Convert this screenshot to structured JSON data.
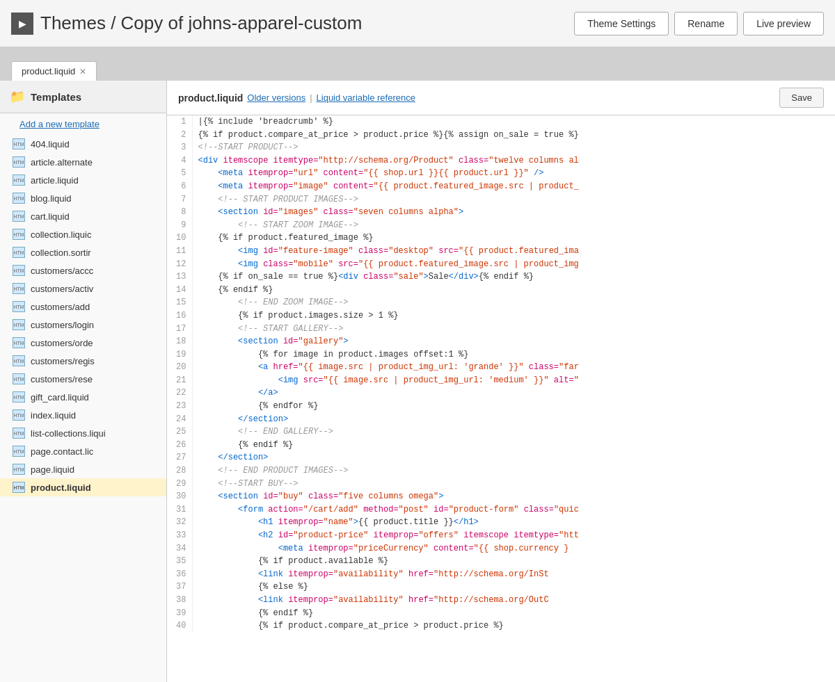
{
  "header": {
    "icon_label": "IMG",
    "title": "Themes / Copy of johns-apparel-custom",
    "theme_settings_label": "Theme Settings",
    "rename_label": "Rename",
    "live_preview_label": "Live preview"
  },
  "tabs": [
    {
      "label": "product.liquid",
      "active": true
    }
  ],
  "sidebar": {
    "title": "Templates",
    "add_template_label": "Add a new template",
    "items": [
      {
        "name": "404.liquid",
        "active": false
      },
      {
        "name": "article.alternate",
        "active": false
      },
      {
        "name": "article.liquid",
        "active": false
      },
      {
        "name": "blog.liquid",
        "active": false
      },
      {
        "name": "cart.liquid",
        "active": false
      },
      {
        "name": "collection.liquic",
        "active": false
      },
      {
        "name": "collection.sortir",
        "active": false
      },
      {
        "name": "customers/accc",
        "active": false
      },
      {
        "name": "customers/activ",
        "active": false
      },
      {
        "name": "customers/add",
        "active": false
      },
      {
        "name": "customers/login",
        "active": false
      },
      {
        "name": "customers/orde",
        "active": false
      },
      {
        "name": "customers/regis",
        "active": false
      },
      {
        "name": "customers/rese",
        "active": false
      },
      {
        "name": "gift_card.liquid",
        "active": false
      },
      {
        "name": "index.liquid",
        "active": false
      },
      {
        "name": "list-collections.liqui",
        "active": false
      },
      {
        "name": "page.contact.lic",
        "active": false
      },
      {
        "name": "page.liquid",
        "active": false
      },
      {
        "name": "product.liquid",
        "active": true
      }
    ]
  },
  "editor": {
    "filename": "product.liquid",
    "older_versions_label": "Older versions",
    "liquid_variable_reference_label": "Liquid variable reference",
    "save_label": "Save"
  }
}
